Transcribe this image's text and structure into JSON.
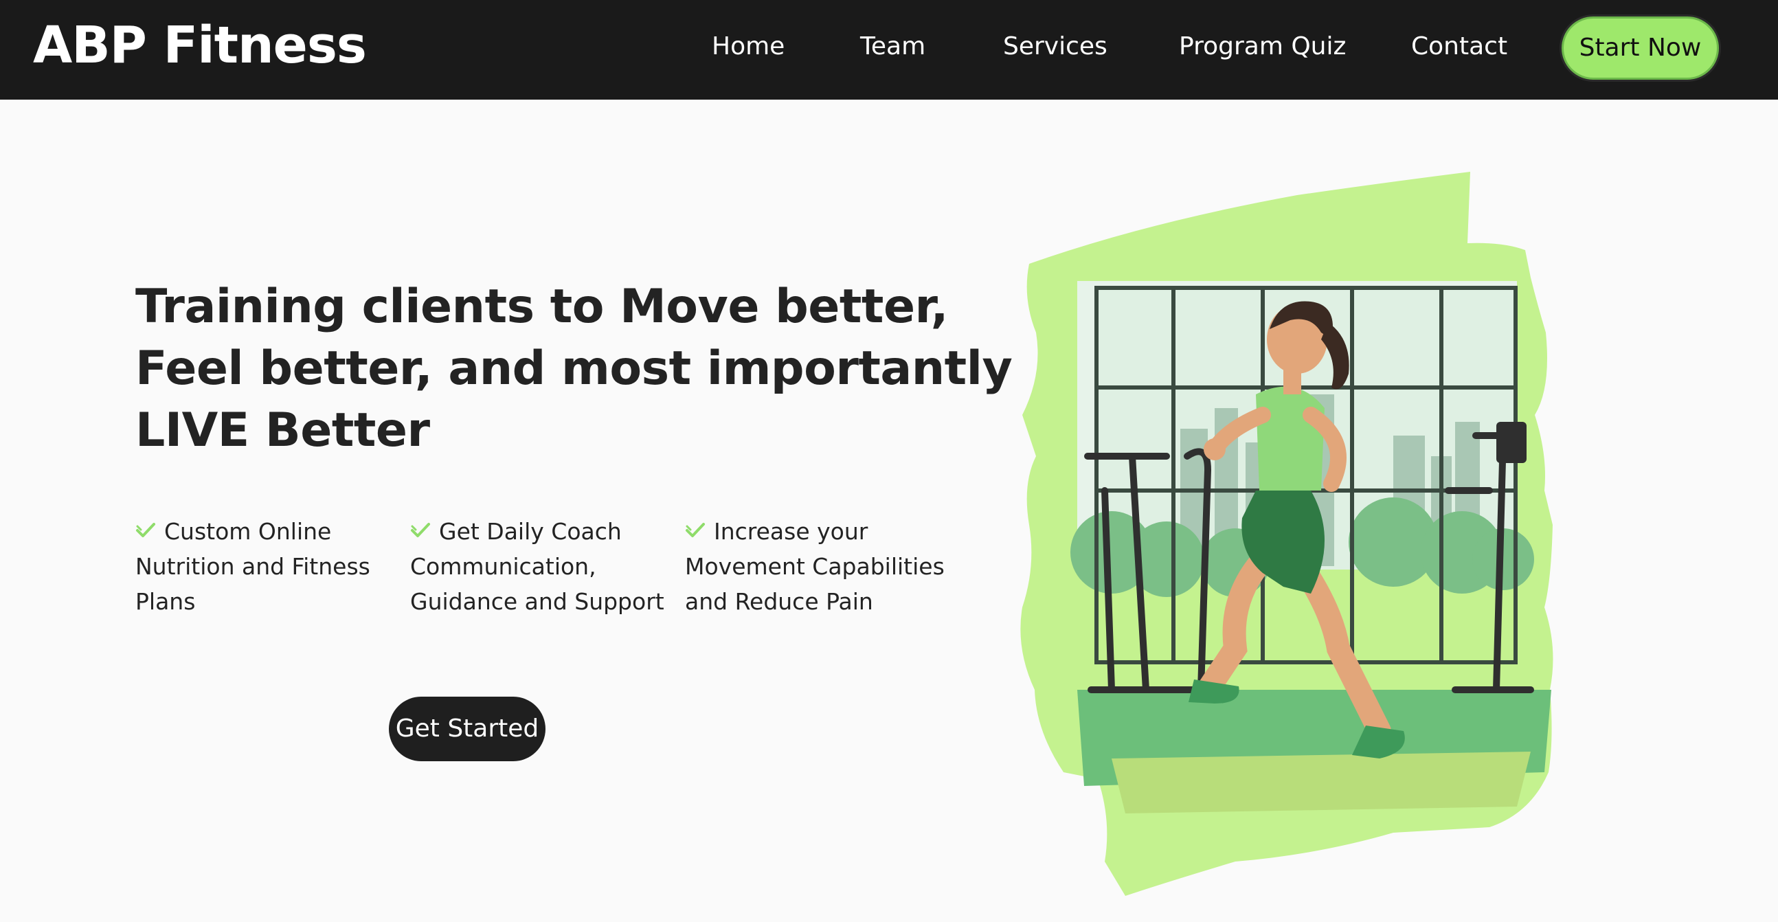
{
  "brand": {
    "name": "ABP Fitness"
  },
  "nav": {
    "items": [
      {
        "label": "Home"
      },
      {
        "label": "Team"
      },
      {
        "label": "Services"
      },
      {
        "label": "Program Quiz"
      },
      {
        "label": "Contact"
      }
    ],
    "cta_label": "Start Now"
  },
  "hero": {
    "title_lines": [
      "Training clients to Move better,",
      "Feel better, and most importantly",
      "LIVE Better"
    ],
    "features": [
      {
        "lines": [
          "Custom Online",
          "Nutrition and Fitness",
          "Plans"
        ]
      },
      {
        "lines": [
          "Get Daily Coach",
          "Communication,",
          "Guidance and Support"
        ]
      },
      {
        "lines": [
          "Increase your",
          "Movement Capabilities",
          "and Reduce Pain"
        ]
      }
    ],
    "cta_label": "Get Started"
  },
  "illustration": {
    "icon": "woman-running-gym-illustration"
  },
  "colors": {
    "nav_bg": "#1a1a1a",
    "accent_green": "#9ee86b",
    "check_green": "#8fdc6a",
    "text_dark": "#232323",
    "page_bg": "#fafafa"
  }
}
